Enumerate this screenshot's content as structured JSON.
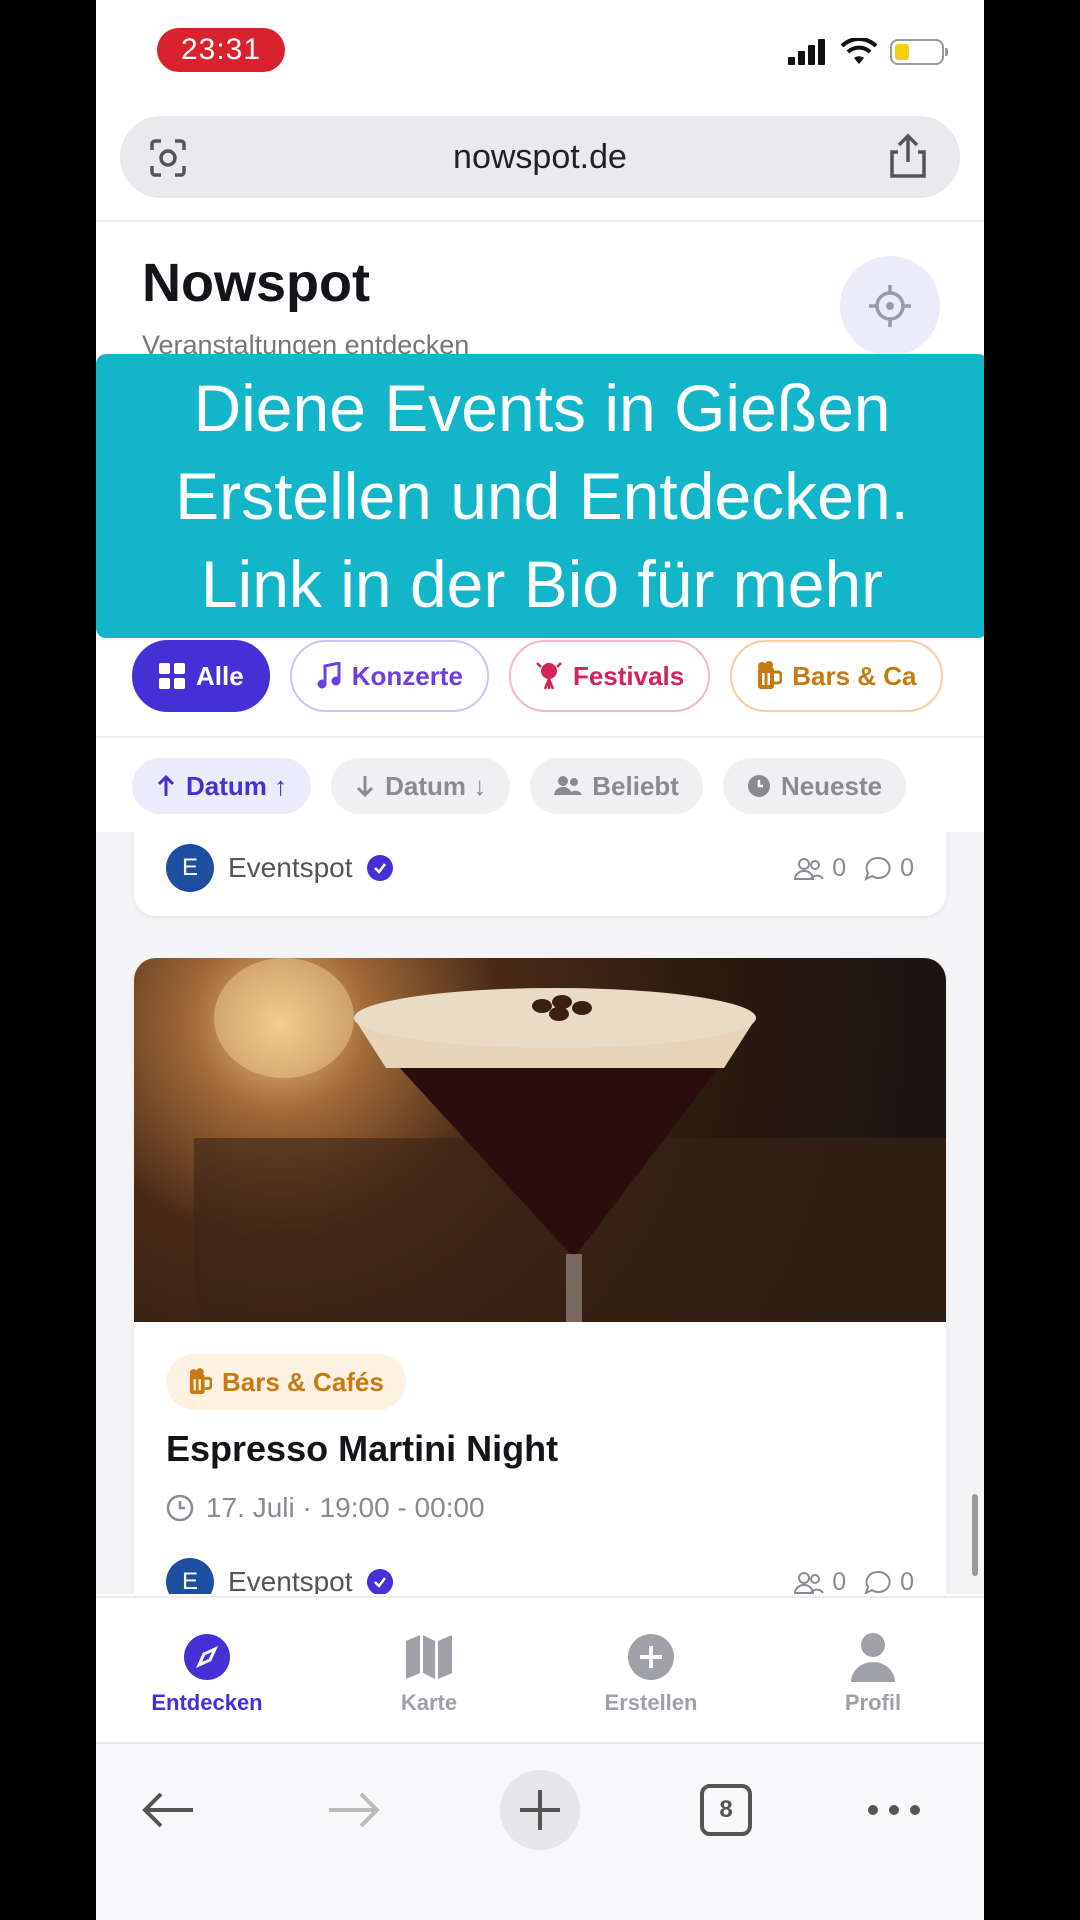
{
  "status": {
    "time": "23:31"
  },
  "browser": {
    "url": "nowspot.de",
    "tab_count": "8"
  },
  "header": {
    "title": "Nowspot",
    "subtitle": "Veranstaltungen entdecken"
  },
  "banner": {
    "lines": [
      "Diene Events in Gießen",
      "Erstellen und Entdecken.",
      "Link in der Bio für mehr"
    ]
  },
  "categories": [
    {
      "label": "Alle",
      "icon": "grid-icon"
    },
    {
      "label": "Konzerte",
      "icon": "music-note-icon"
    },
    {
      "label": "Festivals",
      "icon": "festival-icon"
    },
    {
      "label": "Bars & Ca",
      "icon": "beer-mug-icon"
    }
  ],
  "sort_options": [
    {
      "label": "Datum ↑",
      "icon": "arrow-up-icon"
    },
    {
      "label": "Datum ↓",
      "icon": "arrow-down-icon"
    },
    {
      "label": "Beliebt",
      "icon": "people-icon"
    },
    {
      "label": "Neueste",
      "icon": "clock-icon"
    }
  ],
  "events": [
    {
      "author": "Eventspot",
      "avatar_letter": "E",
      "attendees": "0",
      "comments": "0"
    },
    {
      "category": "Bars & Cafés",
      "title": "Espresso Martini Night",
      "time": "17. Juli · 19:00 - 00:00",
      "author": "Eventspot",
      "avatar_letter": "E",
      "attendees": "0",
      "comments": "0"
    }
  ],
  "tabs": [
    {
      "label": "Entdecken",
      "icon": "compass-icon"
    },
    {
      "label": "Karte",
      "icon": "map-icon"
    },
    {
      "label": "Erstellen",
      "icon": "plus-circle-icon"
    },
    {
      "label": "Profil",
      "icon": "person-icon"
    }
  ],
  "colors": {
    "accent": "#4530d6",
    "banner": "#13b5c9",
    "status_time_bg": "#d9222d"
  }
}
